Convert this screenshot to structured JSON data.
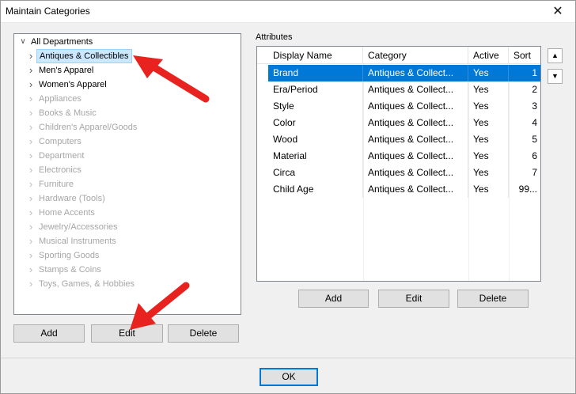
{
  "window": {
    "title": "Maintain Categories",
    "close_glyph": "✕"
  },
  "tree": {
    "root": {
      "label": "All Departments",
      "icon": "chevron-down-icon"
    },
    "items": [
      {
        "label": "Antiques & Collectibles",
        "enabled": true,
        "selected": true
      },
      {
        "label": "Men's Apparel",
        "enabled": true
      },
      {
        "label": "Women's Apparel",
        "enabled": true
      },
      {
        "label": "Appliances",
        "enabled": false
      },
      {
        "label": "Books & Music",
        "enabled": false
      },
      {
        "label": "Children's Apparel/Goods",
        "enabled": false
      },
      {
        "label": "Computers",
        "enabled": false
      },
      {
        "label": "Department",
        "enabled": false
      },
      {
        "label": "Electronics",
        "enabled": false
      },
      {
        "label": "Furniture",
        "enabled": false
      },
      {
        "label": "Hardware (Tools)",
        "enabled": false
      },
      {
        "label": "Home Accents",
        "enabled": false
      },
      {
        "label": "Jewelry/Accessories",
        "enabled": false
      },
      {
        "label": "Musical Instruments",
        "enabled": false
      },
      {
        "label": "Sporting Goods",
        "enabled": false
      },
      {
        "label": "Stamps & Coins",
        "enabled": false
      },
      {
        "label": "Toys, Games, & Hobbies",
        "enabled": false
      }
    ],
    "buttons": {
      "add": "Add",
      "edit": "Edit",
      "delete": "Delete"
    }
  },
  "attributes": {
    "label": "Attributes",
    "columns": [
      "Display Name",
      "Category",
      "Active",
      "Sort"
    ],
    "rows": [
      {
        "name": "Brand",
        "category": "Antiques & Collect...",
        "active": "Yes",
        "sort": "1",
        "selected": true
      },
      {
        "name": "Era/Period",
        "category": "Antiques & Collect...",
        "active": "Yes",
        "sort": "2"
      },
      {
        "name": "Style",
        "category": "Antiques & Collect...",
        "active": "Yes",
        "sort": "3"
      },
      {
        "name": "Color",
        "category": "Antiques & Collect...",
        "active": "Yes",
        "sort": "4"
      },
      {
        "name": "Wood",
        "category": "Antiques & Collect...",
        "active": "Yes",
        "sort": "5"
      },
      {
        "name": "Material",
        "category": "Antiques & Collect...",
        "active": "Yes",
        "sort": "6"
      },
      {
        "name": "Circa",
        "category": "Antiques & Collect...",
        "active": "Yes",
        "sort": "7"
      },
      {
        "name": "Child Age",
        "category": "Antiques & Collect...",
        "active": "Yes",
        "sort": "99..."
      }
    ],
    "scroll_up_glyph": "▲",
    "scroll_down_glyph": "▼",
    "buttons": {
      "add": "Add",
      "edit": "Edit",
      "delete": "Delete"
    }
  },
  "footer": {
    "ok": "OK"
  },
  "colors": {
    "selection": "#0078d7",
    "tree_selection": "#cce8ff",
    "annotation_arrow": "#e8231f"
  }
}
